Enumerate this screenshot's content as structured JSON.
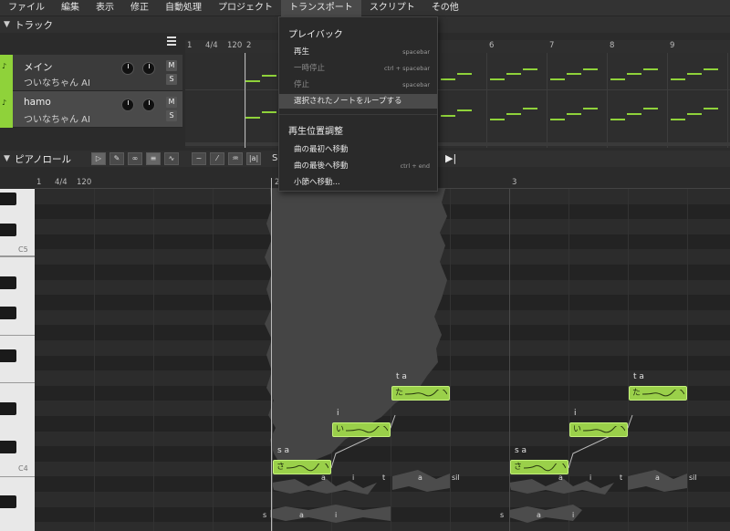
{
  "menubar": {
    "items": [
      "ファイル",
      "編集",
      "表示",
      "修正",
      "自動処理",
      "プロジェクト",
      "トランスポート",
      "スクリプト",
      "その他"
    ]
  },
  "tracks_section": {
    "title": "トラック",
    "tracks": [
      {
        "name": "メイン",
        "singer": "ついなちゃん AI",
        "mute": "M",
        "solo": "S"
      },
      {
        "name": "hamo",
        "singer": "ついなちゃん AI",
        "mute": "M",
        "solo": "S"
      }
    ],
    "ruler": {
      "bar1": "1",
      "time_sig": "4/4",
      "tempo": "120",
      "bar2": "2",
      "bar6": "6",
      "bar7": "7",
      "bar8": "8",
      "bar9": "9"
    }
  },
  "piano_roll": {
    "title": "ピアノロール",
    "toolbar_label": "S",
    "ruler": {
      "bar1": "1",
      "time_sig": "4/4",
      "tempo": "120",
      "bar2": "2",
      "bar3": "3"
    },
    "key_labels": {
      "c5": "C5",
      "c4": "C4"
    },
    "notes": [
      {
        "text": "さ",
        "lyric": "s a"
      },
      {
        "text": "い",
        "lyric": "i"
      },
      {
        "text": "た",
        "lyric": "t a"
      },
      {
        "text": "さ",
        "lyric": "s a"
      },
      {
        "text": "い",
        "lyric": "i"
      },
      {
        "text": "た",
        "lyric": "t a"
      }
    ],
    "phonemes_row1": [
      "a",
      "i",
      "t",
      "a",
      "sil",
      "a",
      "i",
      "t",
      "a",
      "sil"
    ],
    "phonemes_row2": [
      "s",
      "a",
      "i",
      "s",
      "a",
      "i"
    ]
  },
  "transport_menu": {
    "playback_header": "プレイバック",
    "items": [
      {
        "label": "再生",
        "shortcut": "spacebar",
        "disabled": false
      },
      {
        "label": "一時停止",
        "shortcut": "ctrl + spacebar",
        "disabled": true
      },
      {
        "label": "停止",
        "shortcut": "spacebar",
        "disabled": true
      },
      {
        "label": "選択されたノートをループする",
        "shortcut": "",
        "disabled": false
      }
    ],
    "position_header": "再生位置調整",
    "position_items": [
      {
        "label": "曲の最初へ移動",
        "shortcut": ""
      },
      {
        "label": "曲の最後へ移動",
        "shortcut": "ctrl + end"
      },
      {
        "label": "小節へ移動...",
        "shortcut": ""
      }
    ]
  },
  "colors": {
    "accent": "#8fd23a",
    "note": "#9ad04a"
  }
}
